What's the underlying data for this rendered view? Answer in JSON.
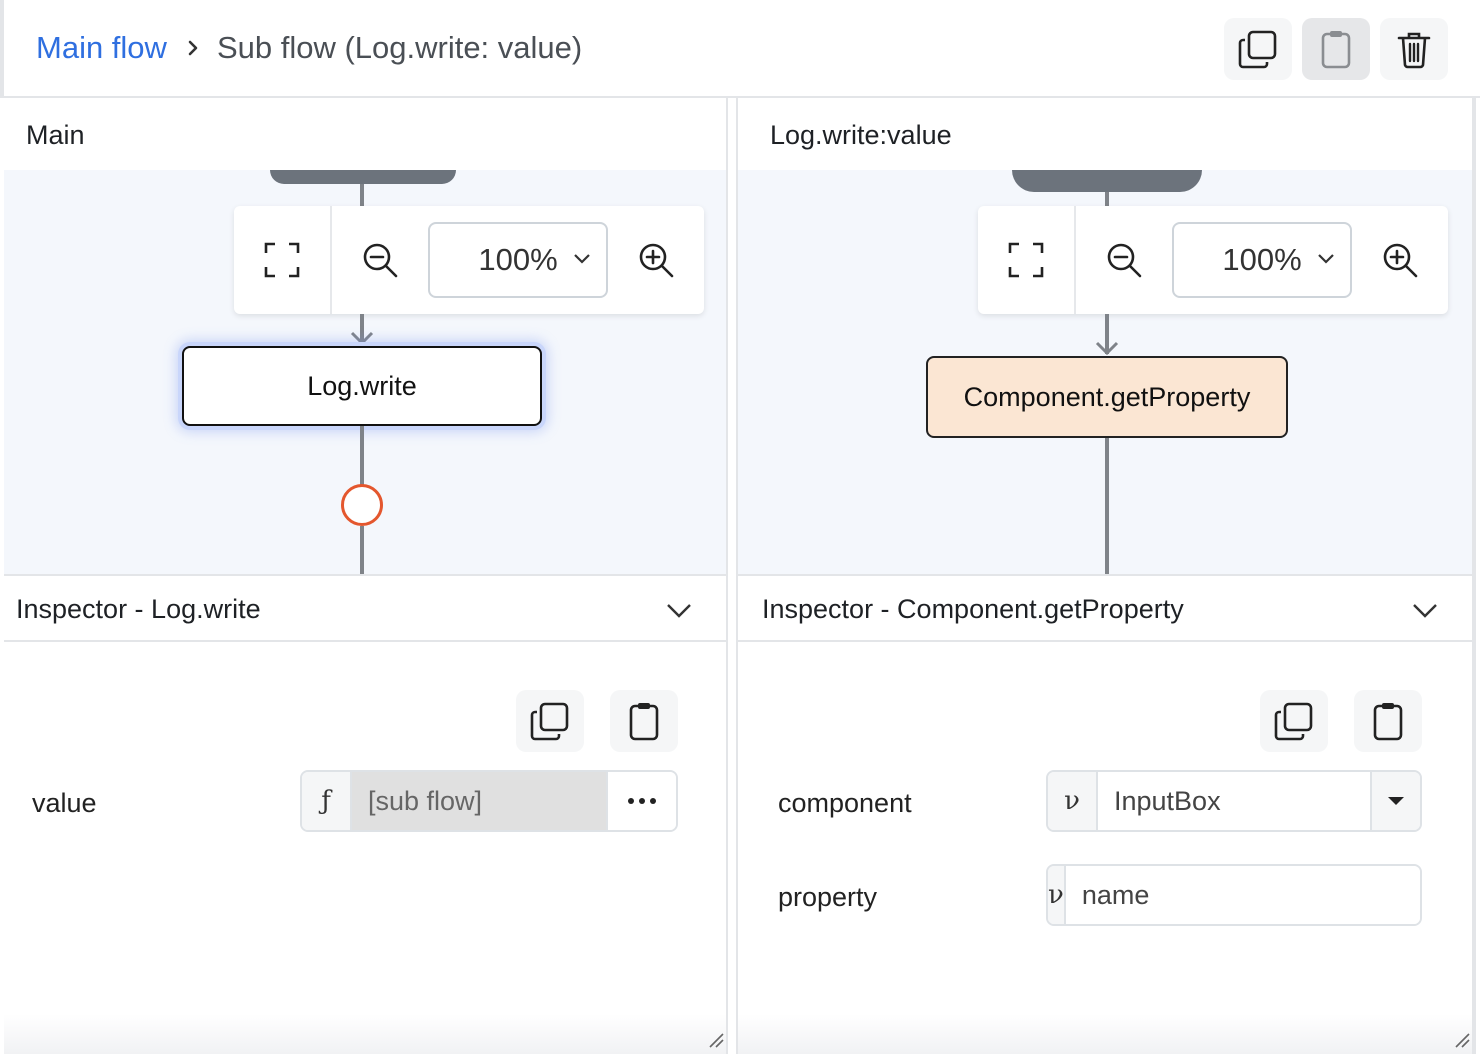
{
  "breadcrumb": {
    "root": "Main flow",
    "current": "Sub flow (Log.write: value)"
  },
  "toolbar": {
    "icons": [
      "copy-icon",
      "clipboard-icon",
      "trash-icon"
    ]
  },
  "left_panel": {
    "title": "Main",
    "zoom": {
      "value": "100%"
    },
    "node": {
      "label": "Log.write"
    },
    "inspector": {
      "title": "Inspector - Log.write",
      "properties": [
        {
          "label": "value",
          "prefix": "ƒ",
          "value": "[sub flow]"
        }
      ]
    }
  },
  "right_panel": {
    "title": "Log.write:value",
    "zoom": {
      "value": "100%"
    },
    "node": {
      "label": "Component.getProperty"
    },
    "inspector": {
      "title": "Inspector - Component.getProperty",
      "properties": [
        {
          "label": "component",
          "prefix": "ν",
          "value": "InputBox"
        },
        {
          "label": "property",
          "prefix": "ν",
          "value": "name"
        }
      ]
    }
  },
  "colors": {
    "link": "#2f6fe0",
    "canvas_bg": "#f4f7fc",
    "node_highlight": "#c9d6fb",
    "getproperty_fill": "#fbe6d3",
    "port_stroke": "#e4572e"
  }
}
